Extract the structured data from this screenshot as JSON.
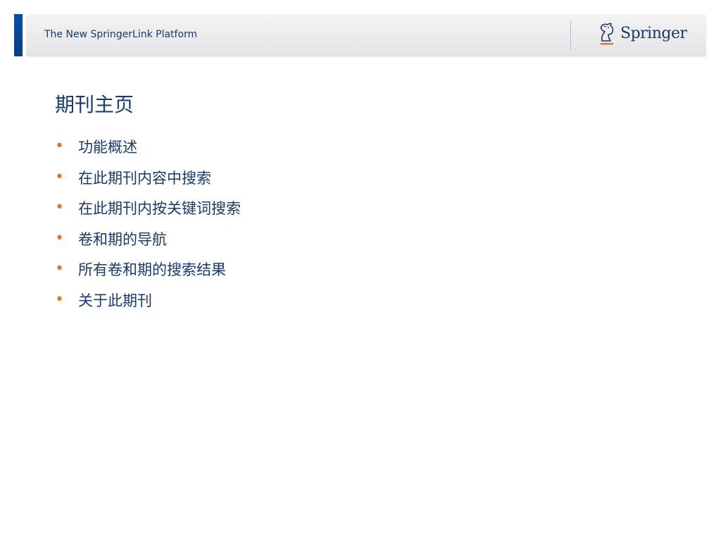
{
  "header": {
    "title": "The New SpringerLink Platform",
    "logo_text": "Springer",
    "accent_color": "#0b4ea2"
  },
  "slide": {
    "title": "期刊主页",
    "bullet_color": "#e8742a",
    "text_color": "#1a3a6b",
    "bullets": [
      "功能概述",
      "在此期刊内容中搜索",
      "在此期刊内按关键词搜索",
      "卷和期的导航",
      "所有卷和期的搜索结果",
      "关于此期刊"
    ]
  }
}
